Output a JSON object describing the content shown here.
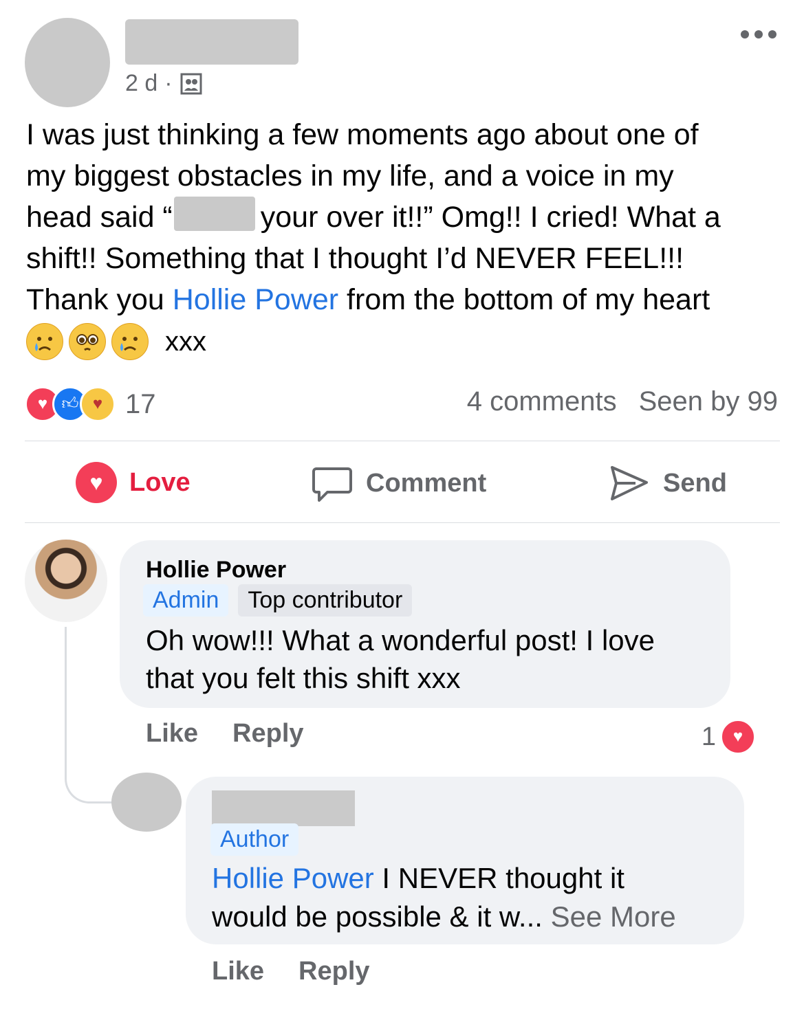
{
  "post": {
    "time": "2 d",
    "separator": "·",
    "audience_icon": "group-icon",
    "more_icon": "more-icon",
    "text_line1": "I was just thinking a few moments ago about one of",
    "text_line2": "my biggest obstacles in my life, and a voice in my",
    "text_line3a": "head said “",
    "text_line3b": "your over it!!” Omg!! I cried! What a",
    "text_line4": "shift!! Something that I thought I’d NEVER FEEL!!!",
    "text_line5a": "Thank you ",
    "mention": "Hollie Power",
    "text_line5b": " from the bottom of my heart",
    "emojis": [
      "😢",
      "🥺",
      "😢"
    ],
    "emoji_tail": "xxx"
  },
  "reactions": {
    "icons": [
      "love-icon",
      "like-icon",
      "care-icon"
    ],
    "count": "17",
    "comments": "4 comments",
    "seen": "Seen by 99"
  },
  "actions": {
    "love": "Love",
    "comment": "Comment",
    "send": "Send"
  },
  "comments": [
    {
      "name": "Hollie Power",
      "badges": [
        "Admin",
        "Top contributor"
      ],
      "text_line1": "Oh wow!!! What a wonderful post! I love",
      "text_line2": "that you felt this shift xxx",
      "like": "Like",
      "reply": "Reply",
      "reaction_count": "1"
    },
    {
      "badge": "Author",
      "mention": "Hollie Power",
      "text_line1": " I NEVER thought it",
      "text_line2": "would be possible & it w... ",
      "see_more": "See More",
      "like": "Like",
      "reply": "Reply"
    }
  ],
  "colors": {
    "accent_blue": "#2374e1",
    "love_red": "#f33e58",
    "muted": "#65676b",
    "bubble": "#f0f2f5"
  }
}
